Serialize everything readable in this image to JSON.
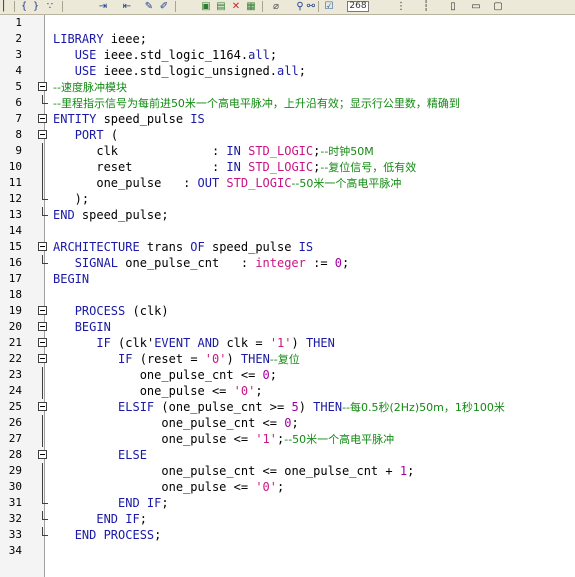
{
  "toolbar": {
    "zoom_value": "268"
  },
  "line_numbers": [
    "1",
    "2",
    "3",
    "4",
    "5",
    "6",
    "7",
    "8",
    "9",
    "10",
    "11",
    "12",
    "13",
    "14",
    "15",
    "16",
    "17",
    "18",
    "19",
    "20",
    "21",
    "22",
    "23",
    "24",
    "25",
    "26",
    "27",
    "28",
    "29",
    "30",
    "31",
    "32",
    "33",
    "34"
  ],
  "code_lines": [
    [],
    [
      {
        "t": "k",
        "v": "LIBRARY "
      },
      {
        "t": "i",
        "v": "ieee"
      },
      {
        "t": "p",
        "v": ";"
      }
    ],
    [
      {
        "t": "p",
        "v": "   "
      },
      {
        "t": "k",
        "v": "USE "
      },
      {
        "t": "i",
        "v": "ieee"
      },
      {
        "t": "p",
        "v": "."
      },
      {
        "t": "i",
        "v": "std_logic_1164"
      },
      {
        "t": "p",
        "v": "."
      },
      {
        "t": "k",
        "v": "all"
      },
      {
        "t": "p",
        "v": ";"
      }
    ],
    [
      {
        "t": "p",
        "v": "   "
      },
      {
        "t": "k",
        "v": "USE "
      },
      {
        "t": "i",
        "v": "ieee"
      },
      {
        "t": "p",
        "v": "."
      },
      {
        "t": "i",
        "v": "std_logic_unsigned"
      },
      {
        "t": "p",
        "v": "."
      },
      {
        "t": "k",
        "v": "all"
      },
      {
        "t": "p",
        "v": ";"
      }
    ],
    [
      {
        "t": "c",
        "v": "--速度脉冲模块"
      }
    ],
    [
      {
        "t": "c",
        "v": "--里程指示信号为每前进50米一个高电平脉冲，上升沿有效；显示行公里数，精确到"
      }
    ],
    [
      {
        "t": "k",
        "v": "ENTITY "
      },
      {
        "t": "i",
        "v": "speed_pulse "
      },
      {
        "t": "k",
        "v": "IS"
      }
    ],
    [
      {
        "t": "p",
        "v": "   "
      },
      {
        "t": "k",
        "v": "PORT "
      },
      {
        "t": "p",
        "v": "("
      }
    ],
    [
      {
        "t": "p",
        "v": "      "
      },
      {
        "t": "i",
        "v": "clk             "
      },
      {
        "t": "p",
        "v": ": "
      },
      {
        "t": "k",
        "v": "IN "
      },
      {
        "t": "t",
        "v": "STD_LOGIC"
      },
      {
        "t": "p",
        "v": ";"
      },
      {
        "t": "c",
        "v": "--时钟50M"
      }
    ],
    [
      {
        "t": "p",
        "v": "      "
      },
      {
        "t": "i",
        "v": "reset           "
      },
      {
        "t": "p",
        "v": ": "
      },
      {
        "t": "k",
        "v": "IN "
      },
      {
        "t": "t",
        "v": "STD_LOGIC"
      },
      {
        "t": "p",
        "v": ";"
      },
      {
        "t": "c",
        "v": "--复位信号，低有效"
      }
    ],
    [
      {
        "t": "p",
        "v": "      "
      },
      {
        "t": "i",
        "v": "one_pulse   "
      },
      {
        "t": "p",
        "v": ": "
      },
      {
        "t": "k",
        "v": "OUT "
      },
      {
        "t": "t",
        "v": "STD_LOGIC"
      },
      {
        "t": "c",
        "v": "--50米一个高电平脉冲"
      }
    ],
    [
      {
        "t": "p",
        "v": "   );"
      }
    ],
    [
      {
        "t": "k",
        "v": "END "
      },
      {
        "t": "i",
        "v": "speed_pulse"
      },
      {
        "t": "p",
        "v": ";"
      }
    ],
    [],
    [
      {
        "t": "k",
        "v": "ARCHITECTURE "
      },
      {
        "t": "i",
        "v": "trans "
      },
      {
        "t": "k",
        "v": "OF "
      },
      {
        "t": "i",
        "v": "speed_pulse "
      },
      {
        "t": "k",
        "v": "IS"
      }
    ],
    [
      {
        "t": "p",
        "v": "   "
      },
      {
        "t": "k",
        "v": "SIGNAL "
      },
      {
        "t": "i",
        "v": "one_pulse_cnt   "
      },
      {
        "t": "p",
        "v": ": "
      },
      {
        "t": "t",
        "v": "integer "
      },
      {
        "t": "p",
        "v": ":= "
      },
      {
        "t": "n",
        "v": "0"
      },
      {
        "t": "p",
        "v": ";"
      }
    ],
    [
      {
        "t": "k",
        "v": "BEGIN"
      }
    ],
    [],
    [
      {
        "t": "p",
        "v": "   "
      },
      {
        "t": "k",
        "v": "PROCESS "
      },
      {
        "t": "p",
        "v": "("
      },
      {
        "t": "i",
        "v": "clk"
      },
      {
        "t": "p",
        "v": ")"
      }
    ],
    [
      {
        "t": "p",
        "v": "   "
      },
      {
        "t": "k",
        "v": "BEGIN"
      }
    ],
    [
      {
        "t": "p",
        "v": "      "
      },
      {
        "t": "k",
        "v": "IF "
      },
      {
        "t": "p",
        "v": "("
      },
      {
        "t": "i",
        "v": "clk"
      },
      {
        "t": "p",
        "v": "'"
      },
      {
        "t": "k",
        "v": "EVENT AND "
      },
      {
        "t": "i",
        "v": "clk "
      },
      {
        "t": "p",
        "v": "= "
      },
      {
        "t": "s",
        "v": "'1'"
      },
      {
        "t": "p",
        "v": ") "
      },
      {
        "t": "k",
        "v": "THEN"
      }
    ],
    [
      {
        "t": "p",
        "v": "         "
      },
      {
        "t": "k",
        "v": "IF "
      },
      {
        "t": "p",
        "v": "("
      },
      {
        "t": "i",
        "v": "reset "
      },
      {
        "t": "p",
        "v": "= "
      },
      {
        "t": "s",
        "v": "'0'"
      },
      {
        "t": "p",
        "v": ") "
      },
      {
        "t": "k",
        "v": "THEN"
      },
      {
        "t": "c",
        "v": "--复位"
      }
    ],
    [
      {
        "t": "p",
        "v": "            "
      },
      {
        "t": "i",
        "v": "one_pulse_cnt "
      },
      {
        "t": "p",
        "v": "<= "
      },
      {
        "t": "n",
        "v": "0"
      },
      {
        "t": "p",
        "v": ";"
      }
    ],
    [
      {
        "t": "p",
        "v": "            "
      },
      {
        "t": "i",
        "v": "one_pulse "
      },
      {
        "t": "p",
        "v": "<= "
      },
      {
        "t": "s",
        "v": "'0'"
      },
      {
        "t": "p",
        "v": ";"
      }
    ],
    [
      {
        "t": "p",
        "v": "         "
      },
      {
        "t": "k",
        "v": "ELSIF "
      },
      {
        "t": "p",
        "v": "("
      },
      {
        "t": "i",
        "v": "one_pulse_cnt "
      },
      {
        "t": "p",
        "v": ">= "
      },
      {
        "t": "n",
        "v": "5"
      },
      {
        "t": "p",
        "v": ") "
      },
      {
        "t": "k",
        "v": "THEN"
      },
      {
        "t": "c",
        "v": "--每0.5秒(2Hz)50m，1秒100米"
      }
    ],
    [
      {
        "t": "p",
        "v": "               "
      },
      {
        "t": "i",
        "v": "one_pulse_cnt "
      },
      {
        "t": "p",
        "v": "<= "
      },
      {
        "t": "n",
        "v": "0"
      },
      {
        "t": "p",
        "v": ";"
      }
    ],
    [
      {
        "t": "p",
        "v": "               "
      },
      {
        "t": "i",
        "v": "one_pulse "
      },
      {
        "t": "p",
        "v": "<= "
      },
      {
        "t": "s",
        "v": "'1'"
      },
      {
        "t": "p",
        "v": ";"
      },
      {
        "t": "c",
        "v": "--50米一个高电平脉冲"
      }
    ],
    [
      {
        "t": "p",
        "v": "         "
      },
      {
        "t": "k",
        "v": "ELSE"
      }
    ],
    [
      {
        "t": "p",
        "v": "               "
      },
      {
        "t": "i",
        "v": "one_pulse_cnt "
      },
      {
        "t": "p",
        "v": "<= "
      },
      {
        "t": "i",
        "v": "one_pulse_cnt "
      },
      {
        "t": "p",
        "v": "+ "
      },
      {
        "t": "n",
        "v": "1"
      },
      {
        "t": "p",
        "v": ";"
      }
    ],
    [
      {
        "t": "p",
        "v": "               "
      },
      {
        "t": "i",
        "v": "one_pulse "
      },
      {
        "t": "p",
        "v": "<= "
      },
      {
        "t": "s",
        "v": "'0'"
      },
      {
        "t": "p",
        "v": ";"
      }
    ],
    [
      {
        "t": "p",
        "v": "         "
      },
      {
        "t": "k",
        "v": "END IF"
      },
      {
        "t": "p",
        "v": ";"
      }
    ],
    [
      {
        "t": "p",
        "v": "      "
      },
      {
        "t": "k",
        "v": "END IF"
      },
      {
        "t": "p",
        "v": ";"
      }
    ],
    [
      {
        "t": "p",
        "v": "   "
      },
      {
        "t": "k",
        "v": "END PROCESS"
      },
      {
        "t": "p",
        "v": ";"
      }
    ],
    []
  ],
  "fold_markers": [
    "",
    "",
    "",
    "",
    "box",
    "end",
    "box",
    "box",
    "line",
    "line",
    "line",
    "end",
    "end",
    "",
    "box",
    "end",
    "",
    "",
    "box",
    "box",
    "box",
    "box",
    "line",
    "line",
    "box",
    "line",
    "line",
    "box",
    "line",
    "line",
    "end",
    "end",
    "end",
    ""
  ],
  "icons": {
    "toolbar": [
      "indent-icon",
      "outdent-icon",
      "comment-icon",
      "uncomment-icon",
      "copy-icon",
      "paste-icon",
      "cut-icon",
      "delete-icon",
      "bookmark-icon",
      "find-icon",
      "replace-icon",
      "check-icon",
      "zoom-box",
      "dots-icon",
      "page-icon",
      "page-wide-icon",
      "frame-icon"
    ]
  }
}
